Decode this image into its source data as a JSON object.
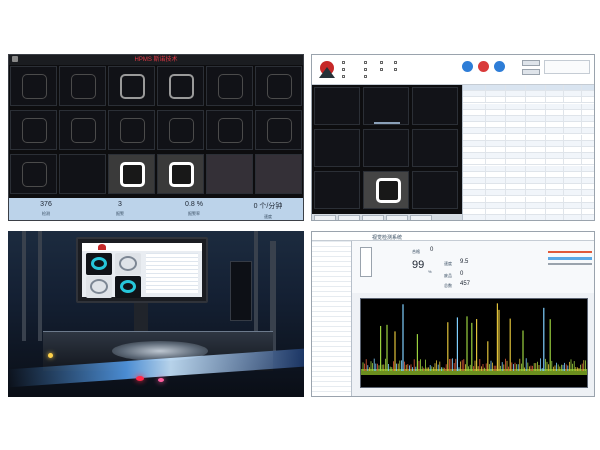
{
  "panel1": {
    "title": "HPMS 斯诺技术",
    "stats": [
      {
        "value": "376",
        "label": "检测"
      },
      {
        "value": "3",
        "label": "报警"
      },
      {
        "value": "0.8 %",
        "label": "报警率"
      },
      {
        "value": "0 个/分钟",
        "label": "速度"
      }
    ],
    "colors": {
      "stats_bar": "#bcd3ea",
      "title_text": "#e63946"
    }
  },
  "panel2": {
    "icons": [
      "logo-icon",
      "start-icon",
      "stop-icon",
      "reset-icon"
    ],
    "button_colors": [
      "#2e7dd7",
      "#d93a3a",
      "#2e7dd7"
    ]
  },
  "panel3": {
    "photo_subject": "inspection-machine-photo"
  },
  "panel4": {
    "header_title": "视觉检测系统",
    "metrics": [
      {
        "label": "合格",
        "value": "0"
      },
      {
        "label": "速度",
        "value": "9.5"
      },
      {
        "label": "废品",
        "value": "0"
      },
      {
        "label": "总数",
        "value": "457"
      }
    ],
    "big_value": "99",
    "big_unit": "%",
    "chart_colors": [
      "#9bd13f",
      "#e0c23a",
      "#e05a3a",
      "#7fd0ff"
    ]
  }
}
